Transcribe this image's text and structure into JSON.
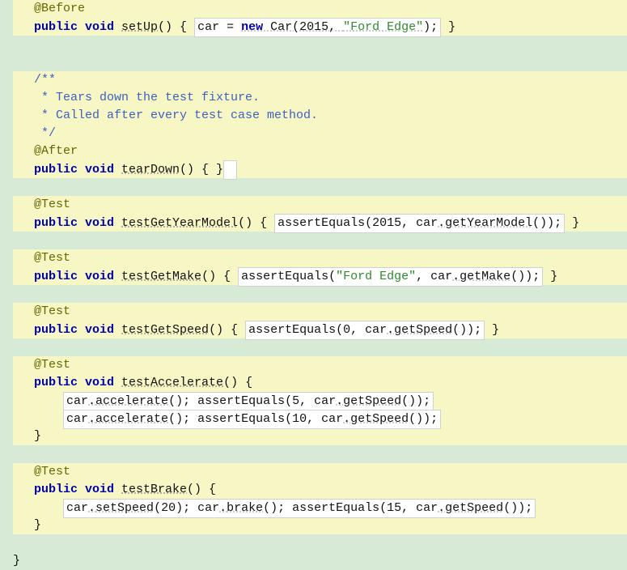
{
  "code": {
    "before": {
      "annotation": "@Before",
      "mods": "public void ",
      "name": "setUp",
      "stmt_prefix": "() { ",
      "box_prefix": "car = ",
      "box_new": "new ",
      "box_call": "Car(2015, ",
      "box_str": "\"Ford Edge\"",
      "box_suffix": ");",
      "stmt_suffix": " }"
    },
    "teardown": {
      "doc_open": "/**",
      "doc_l1": " * Tears down the test fixture.",
      "doc_l2": " * Called after every test case method.",
      "doc_close": " */",
      "annotation": "@After",
      "mods": "public void ",
      "name": "tearDown",
      "sig": "() { }"
    },
    "getYear": {
      "annotation": "@Test",
      "mods": "public void ",
      "name": "testGetYearModel",
      "sig_open": "() { ",
      "box_call": "assertEquals(2015, car",
      "box_dot": ".",
      "box_method": "getYearModel",
      "box_close": "());",
      "sig_close": " }"
    },
    "getMake": {
      "annotation": "@Test",
      "mods": "public void ",
      "name": "testGetMake",
      "sig_open": "() { ",
      "box_call": "assertEquals(",
      "box_str": "\"Ford Edge\"",
      "box_mid": ", car",
      "box_dot": ".",
      "box_method": "getMake",
      "box_close": "());",
      "sig_close": " }"
    },
    "getSpeed": {
      "annotation": "@Test",
      "mods": "public void ",
      "name": "testGetSpeed",
      "sig_open": "() { ",
      "box_call": "assertEquals(0, car",
      "box_dot": ".",
      "box_method": "getSpeed",
      "box_close": "());",
      "sig_close": " }"
    },
    "accel": {
      "annotation": "@Test",
      "mods": "public void ",
      "name": "testAccelerate",
      "sig_open": "() {",
      "l1_pre": "    ",
      "l1_box": "car",
      "l1_dot1": ".",
      "l1_m1": "accelerate",
      "l1_mid": "(); assertEquals(5, car",
      "l1_dot2": ".",
      "l1_m2": "getSpeed",
      "l1_end": "());",
      "l2_pre": "    ",
      "l2_box": "car",
      "l2_dot1": ".",
      "l2_m1": "accelerate",
      "l2_mid": "(); assertEquals(10, car",
      "l2_dot2": ".",
      "l2_m2": "getSpeed",
      "l2_end": "());",
      "close": "}"
    },
    "brake": {
      "annotation": "@Test",
      "mods": "public void ",
      "name": "testBrake",
      "sig_open": "() {",
      "l1_pre": "    ",
      "l1_box": "car",
      "l1_dot1": ".",
      "l1_m1": "setSpeed",
      "l1_mid1": "(20); car",
      "l1_dot2": ".",
      "l1_m2": "brake",
      "l1_mid2": "(); assertEquals(15, car",
      "l1_dot3": ".",
      "l1_m3": "getSpeed",
      "l1_end": "());",
      "close": "}"
    },
    "class_close": "}"
  }
}
